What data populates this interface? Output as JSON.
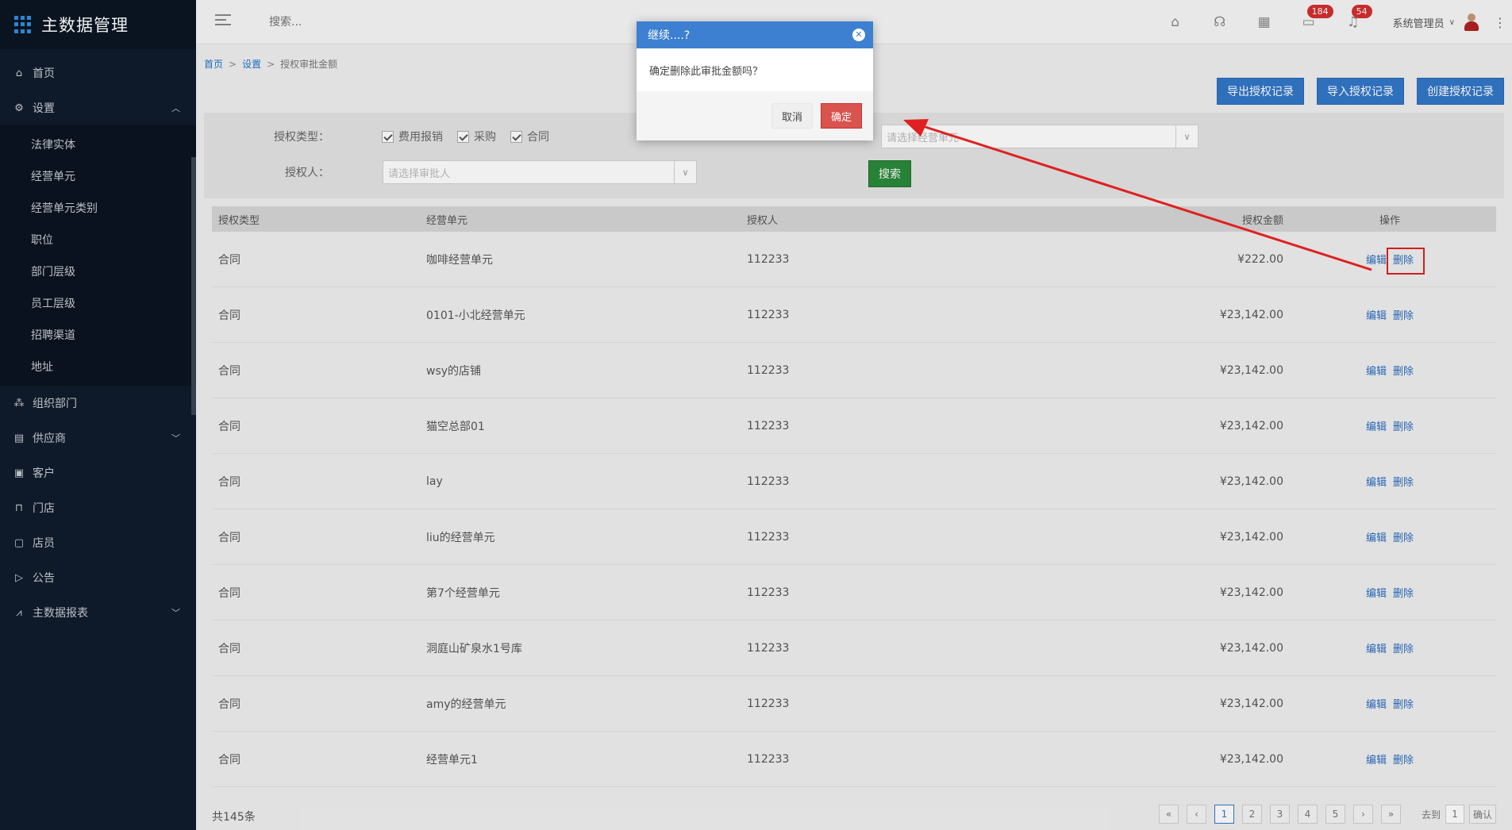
{
  "sidebar": {
    "title": "主数据管理",
    "items": [
      {
        "label": "首页",
        "icon": "home-icon"
      },
      {
        "label": "设置",
        "icon": "gear-icon",
        "expanded": true
      },
      {
        "label": "组织部门",
        "icon": "org-icon"
      },
      {
        "label": "供应商",
        "icon": "supplier-icon"
      },
      {
        "label": "客户",
        "icon": "customer-icon"
      },
      {
        "label": "门店",
        "icon": "store-icon"
      },
      {
        "label": "店员",
        "icon": "staff-icon"
      },
      {
        "label": "公告",
        "icon": "announce-icon"
      },
      {
        "label": "主数据报表",
        "icon": "report-icon"
      }
    ],
    "sub_items": [
      "法律实体",
      "经营单元",
      "经营单元类别",
      "职位",
      "部门层级",
      "员工层级",
      "招聘渠道",
      "地址"
    ]
  },
  "topbar": {
    "search_placeholder": "搜索...",
    "badge_messages": "184",
    "badge_notifications": "54",
    "user_name": "系统管理员"
  },
  "breadcrumb": {
    "home": "首页",
    "settings": "设置",
    "current": "授权审批金额"
  },
  "actions": {
    "export": "导出授权记录",
    "import": "导入授权记录",
    "create": "创建授权记录"
  },
  "filter": {
    "type_label": "授权类型：",
    "options": [
      "费用报销",
      "采购",
      "合同"
    ],
    "approver_label": "授权人：",
    "approver_placeholder": "请选择审批人",
    "unit_placeholder": "请选择经营单元",
    "search_button": "搜索"
  },
  "table": {
    "headers": [
      "授权类型",
      "经营单元",
      "授权人",
      "授权金额",
      "操作"
    ],
    "edit_label": "编辑",
    "delete_label": "删除",
    "rows": [
      {
        "type": "合同",
        "unit": "咖啡经营单元",
        "approver": "112233",
        "amount": "¥222.00"
      },
      {
        "type": "合同",
        "unit": "0101-小北经营单元",
        "approver": "112233",
        "amount": "¥23,142.00"
      },
      {
        "type": "合同",
        "unit": "wsy的店铺",
        "approver": "112233",
        "amount": "¥23,142.00"
      },
      {
        "type": "合同",
        "unit": "猫空总部01",
        "approver": "112233",
        "amount": "¥23,142.00"
      },
      {
        "type": "合同",
        "unit": "lay",
        "approver": "112233",
        "amount": "¥23,142.00"
      },
      {
        "type": "合同",
        "unit": "liu的经营单元",
        "approver": "112233",
        "amount": "¥23,142.00"
      },
      {
        "type": "合同",
        "unit": "第7个经营单元",
        "approver": "112233",
        "amount": "¥23,142.00"
      },
      {
        "type": "合同",
        "unit": "洞庭山矿泉水1号库",
        "approver": "112233",
        "amount": "¥23,142.00"
      },
      {
        "type": "合同",
        "unit": "amy的经营单元",
        "approver": "112233",
        "amount": "¥23,142.00"
      },
      {
        "type": "合同",
        "unit": "经营单元1",
        "approver": "112233",
        "amount": "¥23,142.00"
      }
    ]
  },
  "footer": {
    "total": "共145条",
    "first": "«",
    "prev": "‹",
    "pages": [
      "1",
      "2",
      "3",
      "4",
      "5"
    ],
    "next": "›",
    "last": "»",
    "goto_label": "去到",
    "goto_value": "1",
    "confirm": "确认"
  },
  "modal": {
    "title": "继续....?",
    "message": "确定删除此审批金额吗？",
    "cancel": "取消",
    "confirm": "确定"
  },
  "colors": {
    "annotation": "#e02020",
    "primary": "#3278c8",
    "danger": "#d9534f",
    "success": "#2a8a3a"
  }
}
